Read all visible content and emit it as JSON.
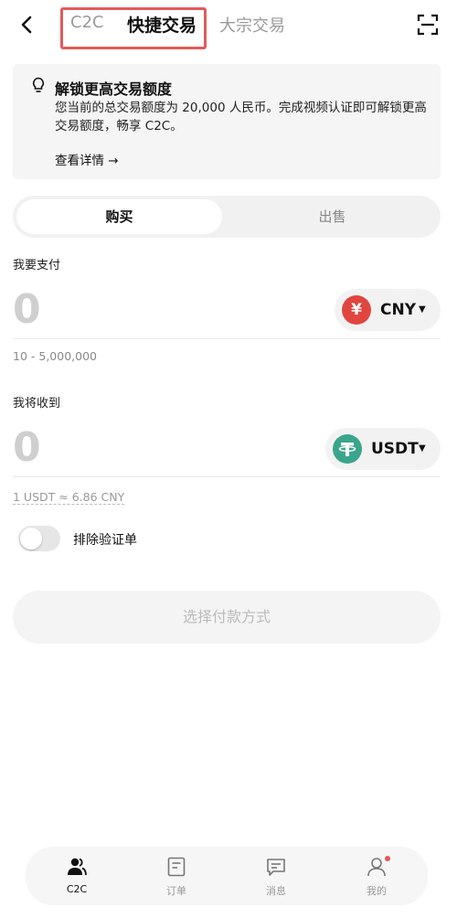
{
  "header": {
    "back_icon": "chevron-left-icon",
    "tabs": [
      {
        "label": "C2C"
      },
      {
        "label": "快捷交易"
      },
      {
        "label": "大宗交易"
      }
    ],
    "scan_icon": "scan-icon",
    "highlight_color": "#e35a5a"
  },
  "banner": {
    "icon": "lightbulb-icon",
    "title": "解锁更高交易额度",
    "text": "您当前的总交易额度为 20,000 人民币。完成视频认证即可解锁更高交易额度，畅享 C2C。",
    "link": "查看详情 →"
  },
  "mode": {
    "buy_label": "购买",
    "sell_label": "出售"
  },
  "pay": {
    "label": "我要支付",
    "amount": "0",
    "currency": "CNY",
    "currency_symbol": "¥",
    "currency_color": "#e0463f",
    "range": "10 - 5,000,000"
  },
  "receive": {
    "label": "我将收到",
    "amount": "0",
    "currency": "USDT",
    "currency_color": "#3aa58a",
    "rate": "1 USDT ≈ 6.86 CNY"
  },
  "exclude": {
    "label": "排除验证单",
    "on": false
  },
  "action": {
    "label": "选择付款方式"
  },
  "nav": {
    "items": [
      {
        "label": "C2C",
        "icon": "users-icon"
      },
      {
        "label": "订单",
        "icon": "document-icon"
      },
      {
        "label": "消息",
        "icon": "message-icon"
      },
      {
        "label": "我的",
        "icon": "profile-icon"
      }
    ]
  }
}
